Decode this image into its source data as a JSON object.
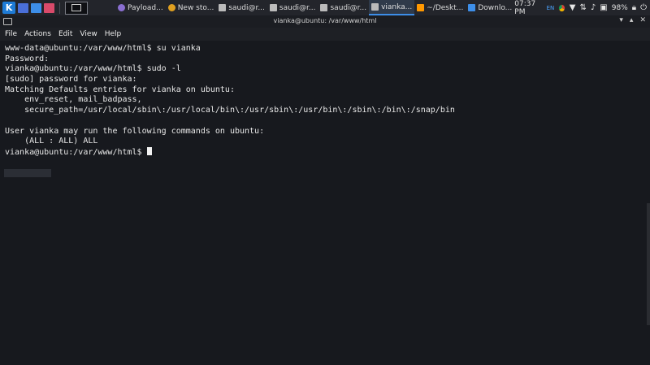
{
  "taskbar": {
    "tasks": [
      {
        "label": "Payload...",
        "icon": "firefox-icon",
        "color": "#8a6fd1"
      },
      {
        "label": "New sto...",
        "icon": "chrome-icon",
        "color": "#e0a020"
      },
      {
        "label": "saudi@r...",
        "icon": "terminal-icon",
        "color": "#cccccc"
      },
      {
        "label": "saudi@r...",
        "icon": "terminal-icon",
        "color": "#cccccc"
      },
      {
        "label": "saudi@r...",
        "icon": "terminal-icon",
        "color": "#cccccc"
      },
      {
        "label": "vianka...",
        "icon": "terminal-icon",
        "color": "#cccccc",
        "active": true
      },
      {
        "label": "~/Deskt...",
        "icon": "sublime-icon",
        "color": "#ff9800"
      },
      {
        "label": "Downlo...",
        "icon": "folder-icon",
        "color": "#3d8ee8"
      }
    ],
    "time": "07:37 PM",
    "lang": "EN",
    "battery": "98%"
  },
  "window": {
    "title": "vianka@ubuntu: /var/www/html"
  },
  "menu": {
    "items": [
      "File",
      "Actions",
      "Edit",
      "View",
      "Help"
    ]
  },
  "terminal": {
    "lines": [
      "www-data@ubuntu:/var/www/html$ su vianka",
      "Password:",
      "vianka@ubuntu:/var/www/html$ sudo -l",
      "[sudo] password for vianka:",
      "Matching Defaults entries for vianka on ubuntu:",
      "    env_reset, mail_badpass,",
      "    secure_path=/usr/local/sbin\\:/usr/local/bin\\:/usr/sbin\\:/usr/bin\\:/sbin\\:/bin\\:/snap/bin",
      "",
      "User vianka may run the following commands on ubuntu:",
      "    (ALL : ALL) ALL"
    ],
    "prompt": "vianka@ubuntu:/var/www/html$ "
  }
}
